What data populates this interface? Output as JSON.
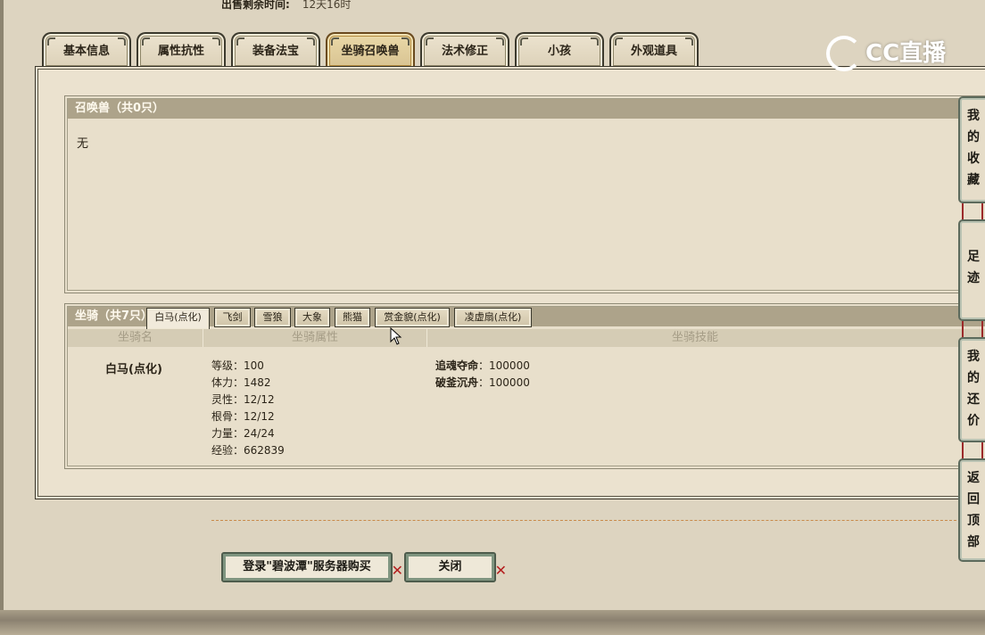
{
  "header": {
    "sale_time_label": "出售剩余时间:",
    "sale_time_value": "12天16时"
  },
  "tabs": [
    {
      "label": "基本信息"
    },
    {
      "label": "属性抗性"
    },
    {
      "label": "装备法宝"
    },
    {
      "label": "坐骑召唤兽",
      "active": true
    },
    {
      "label": "法术修正"
    },
    {
      "label": "小孩"
    },
    {
      "label": "外观道具"
    }
  ],
  "summon_panel": {
    "title": "召唤兽（共0只）",
    "content": "无"
  },
  "mount_panel": {
    "title": "坐骑（共7只）",
    "tabs": [
      {
        "label": "白马(点化)",
        "active": true
      },
      {
        "label": "飞剑"
      },
      {
        "label": "雪狼"
      },
      {
        "label": "大象"
      },
      {
        "label": "熊猫"
      },
      {
        "label": "赏金貌(点化)"
      },
      {
        "label": "凌虚扇(点化)"
      }
    ],
    "columns": [
      "坐骑名",
      "坐骑属性",
      "坐骑技能"
    ],
    "selected": {
      "name": "白马(点化)",
      "attributes": [
        "等级：100",
        "体力：1482",
        "灵性：12/12",
        "根骨：12/12",
        "力量：24/24",
        "经验：662839"
      ],
      "skills": [
        {
          "name": "追魂夺命",
          "value": "100000"
        },
        {
          "name": "破釜沉舟",
          "value": "100000"
        }
      ]
    }
  },
  "buttons": {
    "buy": "登录\"碧波潭\"服务器购买",
    "close": "关闭"
  },
  "side_nav": [
    {
      "label": "我的收藏"
    },
    {
      "label": "足迹"
    },
    {
      "label": "我的还价"
    },
    {
      "label": "返回顶部"
    }
  ],
  "watermark": {
    "text": "CC直播"
  }
}
